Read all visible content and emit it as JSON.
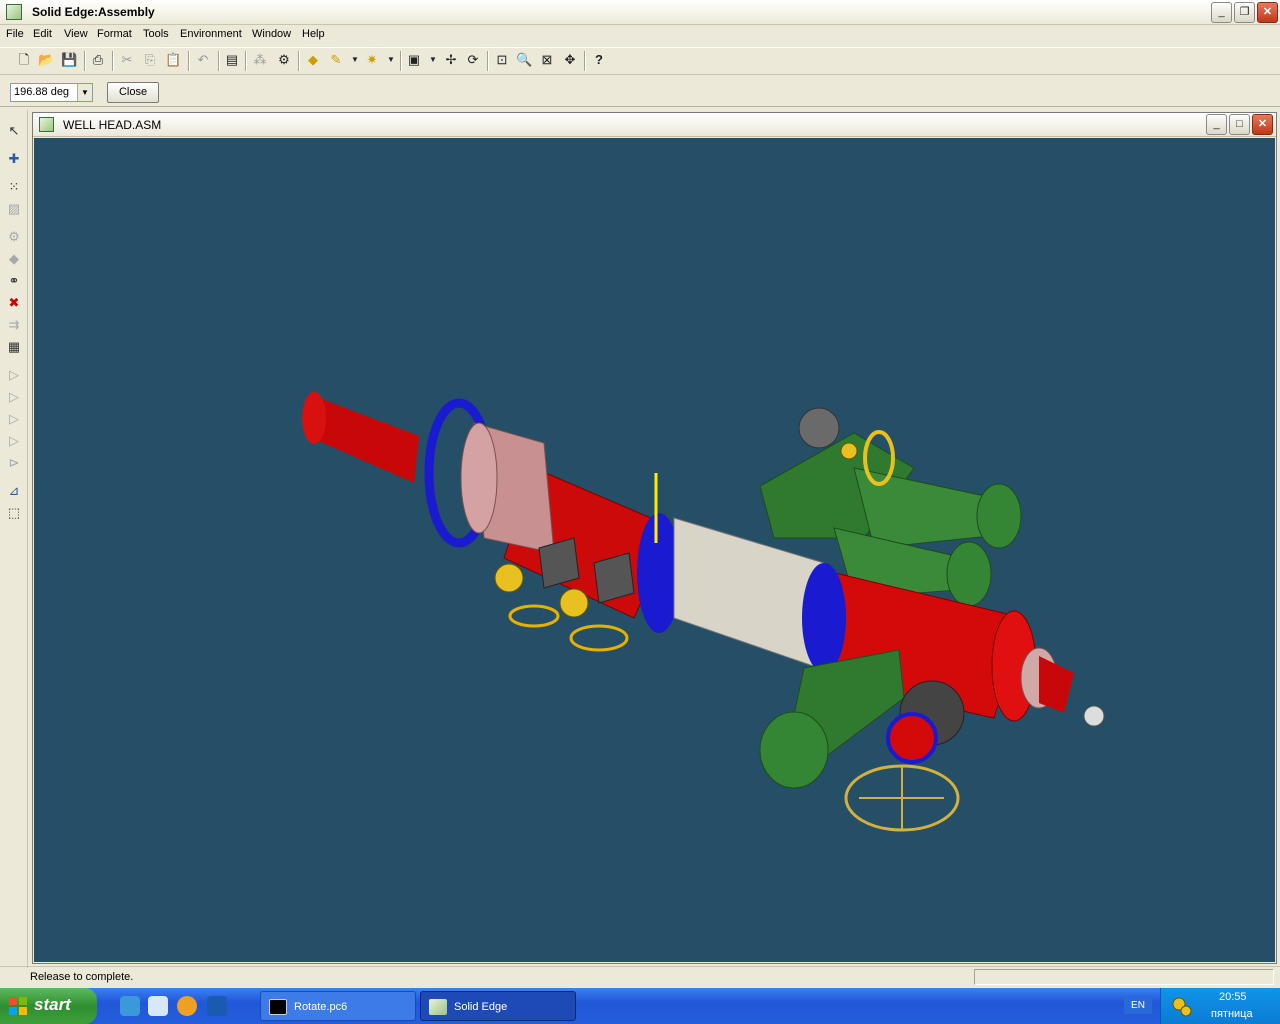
{
  "app": {
    "title": "Solid Edge:Assembly"
  },
  "menu": [
    "File",
    "Edit",
    "View",
    "Format",
    "Tools",
    "Environment",
    "Window",
    "Help"
  ],
  "ribbon": {
    "angle_value": "196.88 deg",
    "close_label": "Close"
  },
  "document": {
    "title": "WELL HEAD.ASM"
  },
  "status": {
    "message": "Release to complete."
  },
  "taskbar": {
    "start_label": "start",
    "tasks": [
      {
        "label": "Rotate.pc6",
        "active": false
      },
      {
        "label": "Solid Edge",
        "active": true
      }
    ],
    "language": "EN",
    "clock": "20:55",
    "day": "пятница"
  },
  "icons": {
    "toolbar": [
      "new-file-icon",
      "open-folder-icon",
      "save-icon",
      "print-icon",
      "cut-icon",
      "copy-icon",
      "paste-icon",
      "undo-icon",
      "save-all-icon",
      "explode-icon",
      "parts-icon",
      "shade-icon",
      "paint-icon",
      "light-icon",
      "view-orient-icon",
      "rotate-axes-icon",
      "spin-icon",
      "zoom-area-icon",
      "zoom-icon",
      "fit-icon",
      "pan-icon",
      "whats-this-icon"
    ],
    "left_toolbar": [
      "select-icon",
      "place-part-icon",
      "pattern-icon",
      "replace-part-icon",
      "gear-icon",
      "mate-icon",
      "assemble-icon",
      "delete-relationship-icon",
      "flow-icon",
      "edit-definition-icon",
      "capture-fit-icon",
      "options-icon",
      "hide-icon",
      "show-icon",
      "link-icon",
      "mirror-icon",
      "coordinate-icon",
      "inspect-icon"
    ]
  },
  "colors": {
    "viewport_bg": "#244f66",
    "pipe_red": "#d40a0a",
    "flange_blue": "#1a1ad0",
    "actuator_green": "#2f7a2f",
    "body_speckle": "#d8d4c8",
    "handwheel_yellow": "#e8c020"
  }
}
